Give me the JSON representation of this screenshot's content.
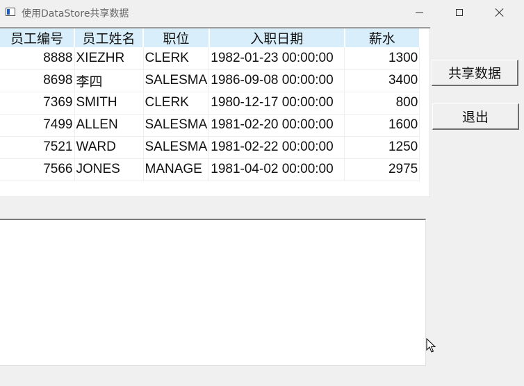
{
  "window": {
    "title": "使用DataStore共享数据"
  },
  "grid": {
    "columns": [
      "员工编号",
      "员工姓名",
      "职位",
      "入职日期",
      "薪水"
    ],
    "rows": [
      [
        "8888",
        "XIEZHR",
        "CLERK",
        "1982-01-23 00:00:00",
        "1300"
      ],
      [
        "8698",
        "李四",
        "SALESMA",
        "1986-09-08 00:00:00",
        "3400"
      ],
      [
        "7369",
        "SMITH",
        "CLERK",
        "1980-12-17 00:00:00",
        "800"
      ],
      [
        "7499",
        "ALLEN",
        "SALESMA",
        "1981-02-20 00:00:00",
        "1600"
      ],
      [
        "7521",
        "WARD",
        "SALESMA",
        "1981-02-22 00:00:00",
        "1250"
      ],
      [
        "7566",
        "JONES",
        "MANAGE",
        "1981-04-02 00:00:00",
        "2975"
      ]
    ]
  },
  "buttons": {
    "share_label": "共享数据",
    "exit_label": "退出"
  },
  "colors": {
    "header_bg": "#d9eefb",
    "window_bg": "#f0f0f0"
  }
}
